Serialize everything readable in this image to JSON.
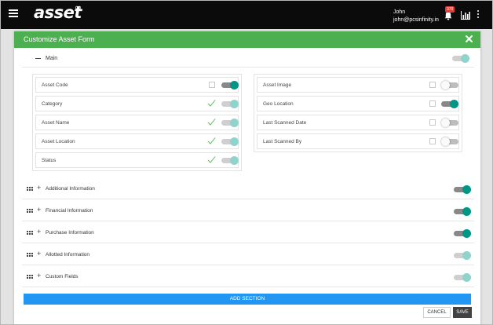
{
  "topbar": {
    "logo_text": "asset",
    "logo_symbol": "∞",
    "user_name": "John",
    "user_email": "john@pcsinfinity.in",
    "notification_count": "370"
  },
  "modal": {
    "title": "Customize Asset Form",
    "main_section": {
      "label": "Main",
      "enabled": true,
      "left_fields": [
        {
          "label": "Asset Code",
          "control": "checkbox",
          "checked": false,
          "toggle": "on"
        },
        {
          "label": "Category",
          "control": "check",
          "checked": true,
          "toggle": "disabled"
        },
        {
          "label": "Asset Name",
          "control": "check",
          "checked": true,
          "toggle": "disabled"
        },
        {
          "label": "Asset Location",
          "control": "check",
          "checked": true,
          "toggle": "disabled"
        },
        {
          "label": "Status",
          "control": "check",
          "checked": true,
          "toggle": "disabled"
        }
      ],
      "right_fields": [
        {
          "label": "Asset Image",
          "control": "checkbox",
          "checked": false,
          "toggle": "off"
        },
        {
          "label": "Geo Location",
          "control": "checkbox",
          "checked": false,
          "toggle": "on"
        },
        {
          "label": "Last Scanned Date",
          "control": "checkbox",
          "checked": false,
          "toggle": "off"
        },
        {
          "label": "Last Scanned By",
          "control": "checkbox",
          "checked": false,
          "toggle": "off"
        }
      ]
    },
    "sections": [
      {
        "label": "Additional Information",
        "toggle": "on"
      },
      {
        "label": "Financial Information",
        "toggle": "on"
      },
      {
        "label": "Purchase Information",
        "toggle": "on"
      },
      {
        "label": "Allotted Information",
        "toggle": "disabled"
      },
      {
        "label": "Custom Fields",
        "toggle": "disabled"
      }
    ],
    "add_section_label": "ADD SECTION",
    "cancel_label": "CANCEL",
    "save_label": "SAVE"
  },
  "colors": {
    "header_green": "#4caf50",
    "toggle_on": "#009688",
    "toggle_disabled": "#8fd4cc",
    "add_button_blue": "#2196f3",
    "topbar_black": "#0b0b0b",
    "check_green": "#5cb85c"
  },
  "icons": {
    "menu": "hamburger-icon",
    "notifications": "bell-icon",
    "reports": "bar-chart-icon",
    "more": "kebab-icon",
    "close": "close-icon",
    "collapse": "minus-icon",
    "expand": "plus-icon",
    "drag": "drag-handle-icon",
    "check": "check-icon"
  }
}
